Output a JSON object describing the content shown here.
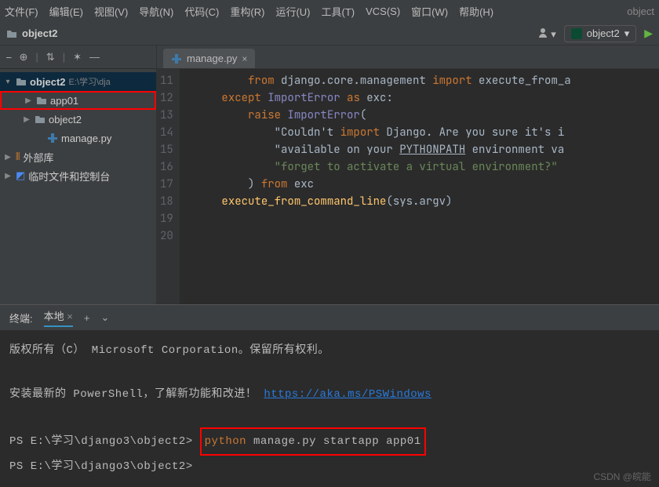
{
  "menu": {
    "file": "文件(F)",
    "edit": "编辑(E)",
    "view": "视图(V)",
    "nav": "导航(N)",
    "code": "代码(C)",
    "refactor": "重构(R)",
    "run": "运行(U)",
    "tools": "工具(T)",
    "vcs": "VCS(S)",
    "window": "窗口(W)",
    "help": "帮助(H)",
    "right": "object"
  },
  "breadcrumb": {
    "project": "object2"
  },
  "runConfig": {
    "name": "object2"
  },
  "sidebar": {
    "root": {
      "name": "object2",
      "path": "E:\\学习\\dja"
    },
    "items": [
      {
        "name": "app01",
        "indent": 28,
        "arrow": "▶",
        "icon": "folder",
        "highlight": true
      },
      {
        "name": "object2",
        "indent": 28,
        "arrow": "▶",
        "icon": "folder"
      },
      {
        "name": "manage.py",
        "indent": 44,
        "arrow": "",
        "icon": "py"
      }
    ],
    "external": "外部库",
    "scratch": "临时文件和控制台"
  },
  "tab": {
    "file": "manage.py"
  },
  "code": {
    "start": 11,
    "lines": [
      "        from django.core.management import execute_from_a",
      "    except ImportError as exc:",
      "        raise ImportError(",
      "            \"Couldn't import Django. Are you sure it's i",
      "            \"available on your PYTHONPATH environment va",
      "            \"forget to activate a virtual environment?\"",
      "        ) from exc",
      "    execute_from_command_line(sys.argv)",
      "",
      ""
    ]
  },
  "terminalTab": {
    "title": "终端:",
    "local": "本地"
  },
  "terminal": {
    "copyright": "版权所有（C） Microsoft Corporation。保留所有权利。",
    "psInfo": "安装最新的 PowerShell，了解新功能和改进！",
    "psLink": "https://aka.ms/PSWindows",
    "prompt": "PS E:\\学习\\django3\\object2>",
    "cmdPy": "python",
    "cmdRest": " manage.py startapp app01"
  },
  "status": "CSDN @皖能"
}
